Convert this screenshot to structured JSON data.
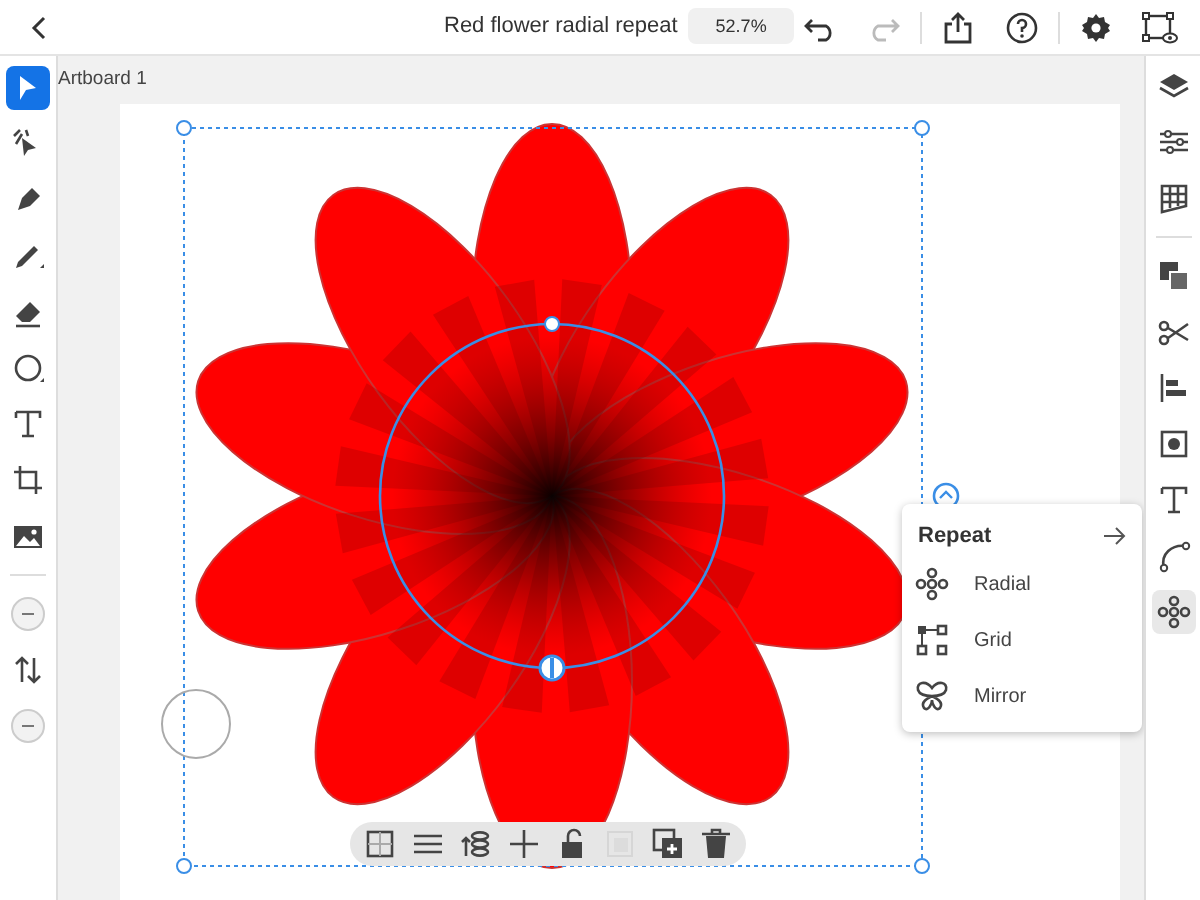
{
  "window": {
    "title": "Red flower radial repeat",
    "zoom": "52.7%"
  },
  "artboard": {
    "label": "Artboard 1"
  },
  "left_tools": [
    {
      "kind": "select",
      "selected": true
    },
    {
      "kind": "direct",
      "selected": false
    },
    {
      "kind": "pen",
      "selected": false
    },
    {
      "kind": "pencil",
      "selected": false
    },
    {
      "kind": "eraser",
      "selected": false
    },
    {
      "kind": "ellipse",
      "selected": false
    },
    {
      "kind": "text",
      "selected": false
    },
    {
      "kind": "crop",
      "selected": false
    },
    {
      "kind": "image",
      "selected": false
    },
    {
      "kind": "divider"
    },
    {
      "kind": "circle",
      "selected": false
    },
    {
      "kind": "swap",
      "selected": false
    },
    {
      "kind": "circle",
      "selected": false
    }
  ],
  "right_tools": [
    {
      "kind": "layers",
      "selected": false
    },
    {
      "kind": "sliders",
      "selected": false
    },
    {
      "kind": "grid",
      "selected": false
    },
    {
      "kind": "divider"
    },
    {
      "kind": "combine",
      "selected": false
    },
    {
      "kind": "scissors",
      "selected": false
    },
    {
      "kind": "align",
      "selected": false
    },
    {
      "kind": "frame",
      "selected": false
    },
    {
      "kind": "text",
      "selected": false
    },
    {
      "kind": "path",
      "selected": false
    },
    {
      "kind": "repeat",
      "selected": true
    }
  ],
  "repeat_menu": {
    "title": "Repeat",
    "items": [
      {
        "kind": "radial",
        "label": "Radial"
      },
      {
        "kind": "grid",
        "label": "Grid"
      },
      {
        "kind": "mirror",
        "label": "Mirror"
      }
    ]
  },
  "selection_toolbar": [
    {
      "kind": "opacity",
      "disabled": false
    },
    {
      "kind": "menu",
      "disabled": false
    },
    {
      "kind": "stack",
      "disabled": false
    },
    {
      "kind": "move",
      "disabled": false
    },
    {
      "kind": "lock",
      "disabled": false
    },
    {
      "kind": "mask",
      "disabled": true
    },
    {
      "kind": "duplicate",
      "disabled": false
    },
    {
      "kind": "trash",
      "disabled": false
    }
  ]
}
